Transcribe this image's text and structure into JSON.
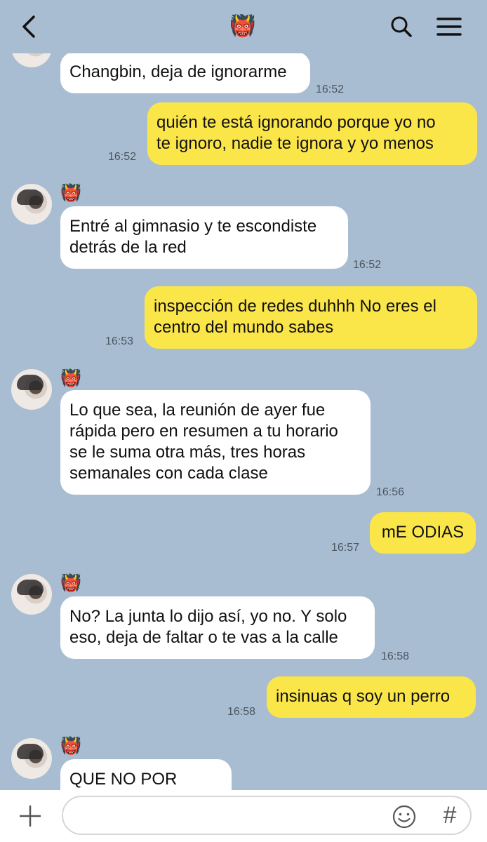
{
  "header": {
    "title_emoji": "👹",
    "back_icon": "chevron-left-icon",
    "search_icon": "search-icon",
    "menu_icon": "menu-icon"
  },
  "messages": [
    {
      "from": "them",
      "text": "Changbin, deja de ignorarme",
      "time": "16:52"
    },
    {
      "from": "me",
      "text": "quién te está ignorando porque yo no\nte ignoro, nadie te ignora y yo menos",
      "time": "16:52"
    },
    {
      "from": "them",
      "text": "Entré al gimnasio y te escondiste\ndetrás de la red",
      "time": "16:52"
    },
    {
      "from": "me",
      "text": "inspección de redes duhhh No eres el\ncentro del mundo sabes",
      "time": "16:53"
    },
    {
      "from": "them",
      "text": "Lo que sea, la reunión de ayer fue\nrápida pero en resumen a tu horario\nse le suma otra más, tres horas\nsemanales con cada clase",
      "time": "16:56"
    },
    {
      "from": "me",
      "text": "mE ODIAS",
      "time": "16:57"
    },
    {
      "from": "them",
      "text": "No? La junta lo dijo así, yo no. Y solo\neso, deja de faltar o te vas a la calle",
      "time": "16:58"
    },
    {
      "from": "me",
      "text": "insinuas q soy un perro",
      "time": "16:58"
    },
    {
      "from": "them",
      "text": "QUE NO POR DIOS",
      "time": ""
    }
  ],
  "sender": {
    "emoji": "👹"
  },
  "composer": {
    "placeholder": "",
    "plus_icon": "plus-icon",
    "emoji_icon": "smiley-icon",
    "hashtag": "#"
  },
  "colors": {
    "background": "#a9bdd2",
    "incoming_bubble": "#ffffff",
    "outgoing_bubble": "#fbe64a"
  }
}
